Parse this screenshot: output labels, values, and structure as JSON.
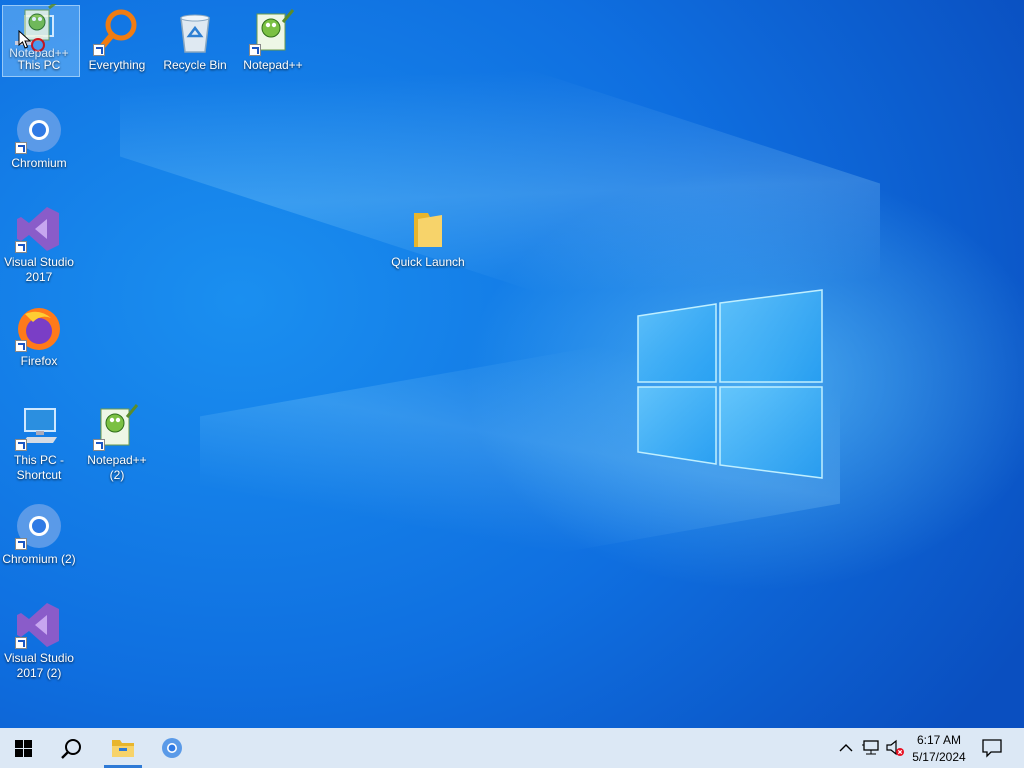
{
  "desktop": {
    "icons": [
      {
        "label": "This PC",
        "type": "pc"
      },
      {
        "label": "Everything",
        "type": "everything"
      },
      {
        "label": "Recycle Bin",
        "type": "recycle"
      },
      {
        "label": "Notepad++",
        "type": "notepad"
      },
      {
        "label": "Chromium",
        "type": "chromium"
      },
      {
        "label": "Visual Studio 2017",
        "type": "vs"
      },
      {
        "label": "Firefox",
        "type": "firefox"
      },
      {
        "label": "This PC - Shortcut",
        "type": "pc"
      },
      {
        "label": "Notepad++ (2)",
        "type": "notepad"
      },
      {
        "label": "Chromium (2)",
        "type": "chromium"
      },
      {
        "label": "Visual Studio 2017 (2)",
        "type": "vs"
      },
      {
        "label": "Quick Launch",
        "type": "folder"
      }
    ],
    "drag_ghost_label": "Notepad++"
  },
  "taskbar": {
    "start": "start-icon",
    "search": "search-icon",
    "pinned": [
      "file-explorer-icon",
      "chromium-icon"
    ],
    "tray": {
      "time": "6:17 AM",
      "date": "5/17/2024"
    }
  },
  "colors": {
    "accent": "#2e7ad6",
    "taskbar": "#dce8f5"
  }
}
